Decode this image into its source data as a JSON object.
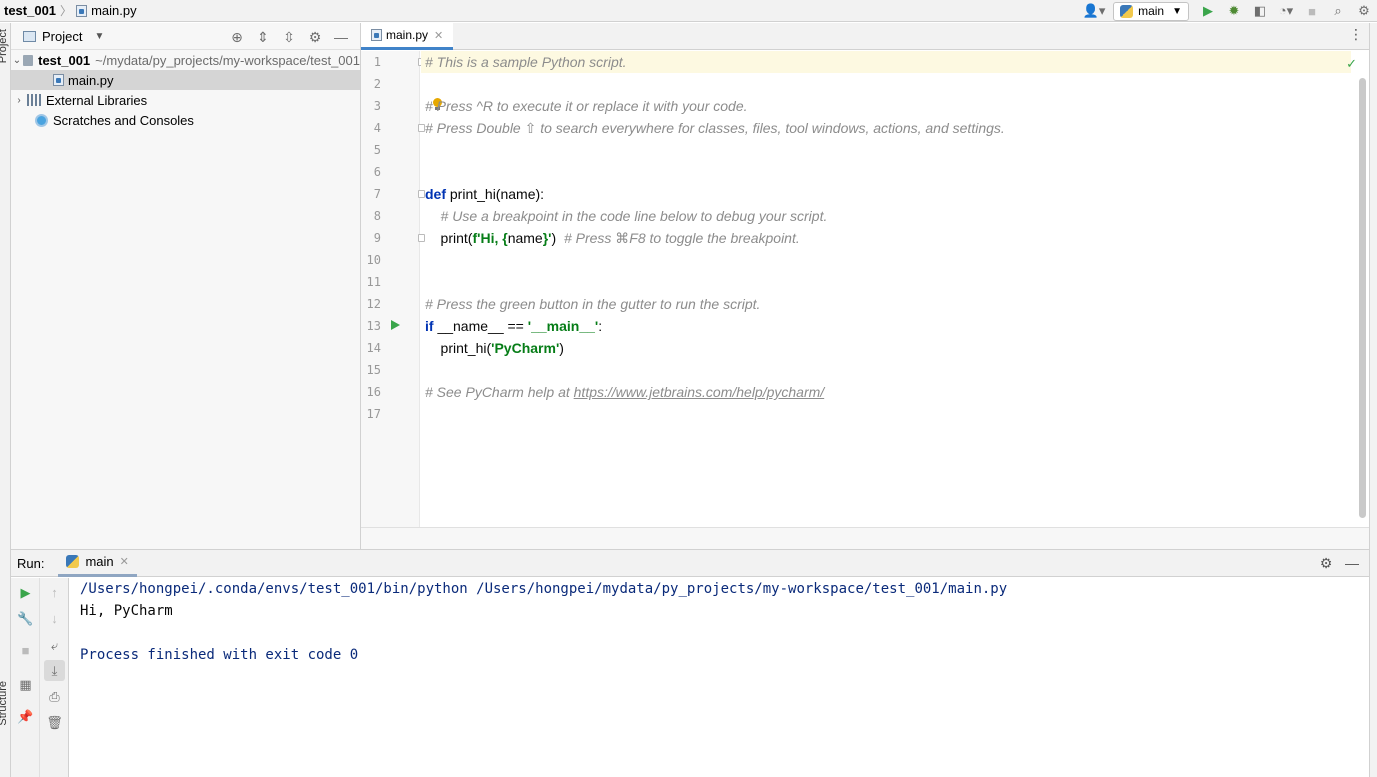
{
  "navbar": {
    "project": "test_001",
    "file": "main.py",
    "run_config": "main",
    "icons": [
      "user-icon",
      "python-icon",
      "run-icon",
      "debug-icon",
      "coverage-icon",
      "profile-icon",
      "stop-icon",
      "search-icon",
      "settings-icon"
    ]
  },
  "left_strip": {
    "top_label": "Project",
    "bottom_label": "Structure"
  },
  "project_panel": {
    "title": "Project",
    "tree": [
      {
        "label": "test_001",
        "path": "~/mydata/py_projects/my-workspace/test_001",
        "type": "folder",
        "expanded": true
      },
      {
        "label": "main.py",
        "type": "python-file",
        "selected": true
      },
      {
        "label": "External Libraries",
        "type": "library",
        "expanded": false
      },
      {
        "label": "Scratches and Consoles",
        "type": "scratches"
      }
    ]
  },
  "editor": {
    "tab": "main.py",
    "line_numbers": [
      "1",
      "2",
      "3",
      "4",
      "5",
      "6",
      "7",
      "8",
      "9",
      "10",
      "11",
      "12",
      "13",
      "14",
      "15",
      "16",
      "17"
    ],
    "lines": {
      "l1": "# This is a sample Python script.",
      "l3": "# Press ^R to execute it or replace it with your code.",
      "l4": "# Press Double ⇧ to search everywhere for classes, files, tool windows, actions, and settings.",
      "l7_kw": "def",
      "l7_rest": " print_hi(name):",
      "l8": "    # Use a breakpoint in the code line below to debug your script.",
      "l9_a": "    print(",
      "l9_str1": "f'Hi, {",
      "l9_mid": "name",
      "l9_str2": "}'",
      "l9_b": ")  ",
      "l9_cmt": "# Press ⌘F8 to toggle the breakpoint.",
      "l12": "# Press the green button in the gutter to run the script.",
      "l13_kw": "if",
      "l13_mid": " __name__ == ",
      "l13_str": "'__main__'",
      "l13_end": ":",
      "l14_a": "    print_hi(",
      "l14_str": "'PyCharm'",
      "l14_b": ")",
      "l16_cmt": "# See PyCharm help at ",
      "l16_link": "https://www.jetbrains.com/help/pycharm/"
    }
  },
  "run_panel": {
    "label": "Run:",
    "tab": "main",
    "output": {
      "command": "/Users/hongpei/.conda/envs/test_001/bin/python /Users/hongpei/mydata/py_projects/my-workspace/test_001/main.py",
      "stdout": "Hi, PyCharm",
      "exit": "Process finished with exit code 0"
    }
  }
}
